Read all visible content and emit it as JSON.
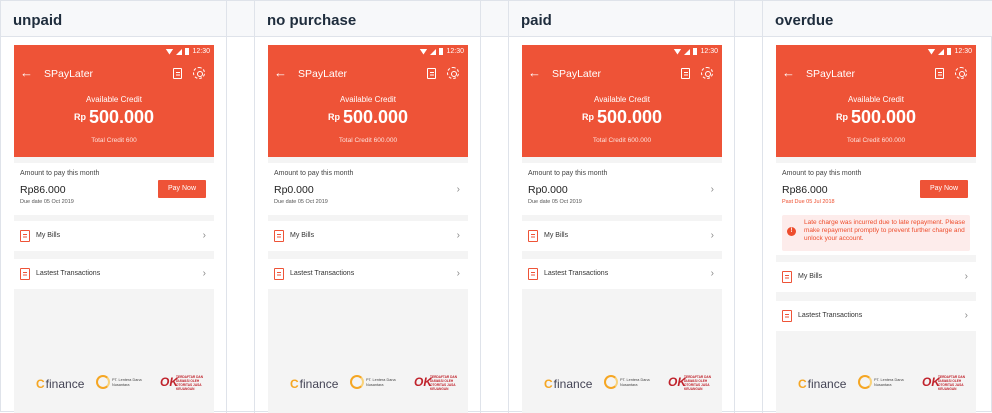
{
  "columns": [
    {
      "title": "unpaid",
      "status_time": "12:30",
      "nav_title": "SPayLater",
      "available_label": "Available Credit",
      "currency": "Rp",
      "available_amount": "500.000",
      "total_credit": "Total Credit 600",
      "pay_label": "Amount to pay this month",
      "pay_amount": "Rp86.000",
      "due": "Due date 05 Oct 2019",
      "pay_button": "Pay Now",
      "my_bills": "My Bills",
      "transactions": "Lastest Transactions",
      "footer_logo": "finance",
      "footer_lentera": "PT. Lentera Dana Nusantara",
      "footer_ojk": "TERDAFTAR DAN DIAWASI OLEH OTORITAS JASA KEUANGAN"
    },
    {
      "title": "no purchase",
      "status_time": "12:30",
      "nav_title": "SPayLater",
      "available_label": "Available Credit",
      "currency": "Rp",
      "available_amount": "500.000",
      "total_credit": "Total Credit 600.000",
      "pay_label": "Amount to pay this month",
      "pay_amount": "Rp0.000",
      "due": "Due date 05 Oct 2019",
      "my_bills": "My Bills",
      "transactions": "Lastest Transactions",
      "footer_logo": "finance",
      "footer_lentera": "PT. Lentera Dana Nusantara",
      "footer_ojk": "TERDAFTAR DAN DIAWASI OLEH OTORITAS JASA KEUANGAN"
    },
    {
      "title": "paid",
      "status_time": "12:30",
      "nav_title": "SPayLater",
      "available_label": "Available Credit",
      "currency": "Rp",
      "available_amount": "500.000",
      "total_credit": "Total Credit 600.000",
      "pay_label": "Amount to pay this month",
      "pay_amount": "Rp0.000",
      "due": "Due date 05 Oct 2019",
      "my_bills": "My Bills",
      "transactions": "Lastest Transactions",
      "footer_logo": "finance",
      "footer_lentera": "PT. Lentera Dana Nusantara",
      "footer_ojk": "TERDAFTAR DAN DIAWASI OLEH OTORITAS JASA KEUANGAN"
    },
    {
      "title": "overdue",
      "status_time": "12:30",
      "nav_title": "SPayLater",
      "available_label": "Available Credit",
      "currency": "Rp",
      "available_amount": "500.000",
      "total_credit": "Total Credit 600.000",
      "pay_label": "Amount to pay this month",
      "pay_amount": "Rp86.000",
      "due": "Past Due 05 Jul 2018",
      "pay_button": "Pay Now",
      "warning": "Late charge was incurred due to late repayment. Please make repayment promptly to prevent further charge and unlock your account.",
      "warning_icon": "!",
      "my_bills": "My Bills",
      "transactions": "Lastest Transactions",
      "footer_logo": "finance",
      "footer_lentera": "PT. Lentera Dana Nusantara",
      "footer_ojk": "TERDAFTAR DAN DIAWASI OLEH OTORITAS JASA KEUANGAN"
    }
  ],
  "icons": {
    "back": "arrow-left-icon",
    "bill": "bill-icon",
    "settings": "gear-icon",
    "chevron": "chevron-right-icon"
  },
  "colors": {
    "brand_orange": "#ee5337",
    "alert_red": "#ee4d2d",
    "alert_bg": "#fdeceb"
  }
}
